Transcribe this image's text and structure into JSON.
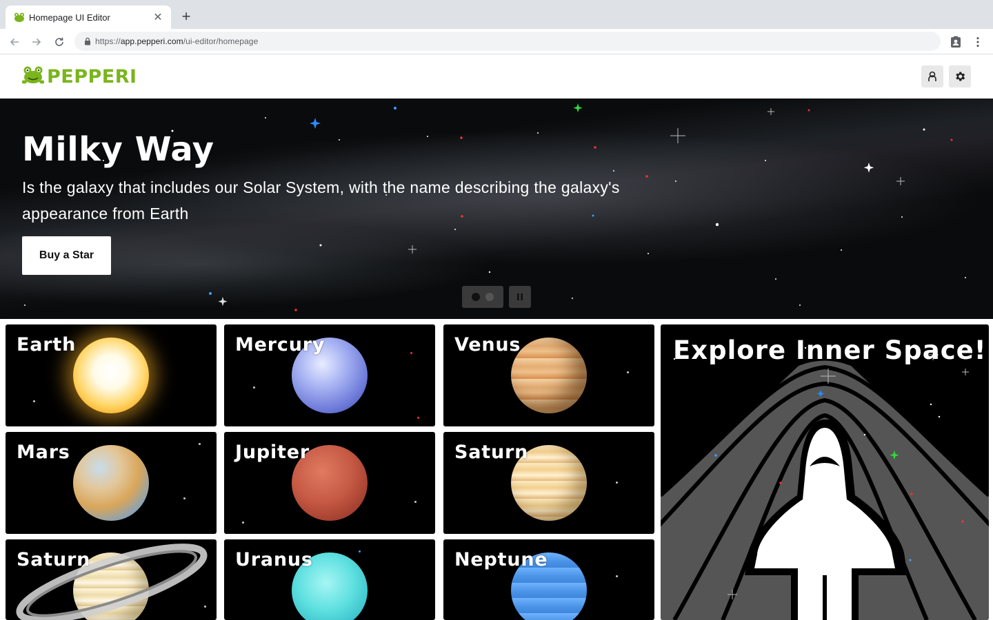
{
  "browser": {
    "tab_title": "Homepage UI Editor",
    "url_scheme": "https://",
    "url_host": "app.pepperi.com",
    "url_path": "/ui-editor/homepage"
  },
  "header": {
    "logo_text": "PEPPERI",
    "brand_color": "#7ab51d"
  },
  "hero": {
    "title": "Milky Way",
    "subtitle": "Is the galaxy that includes our Solar System, with the name describing the galaxy's appearance from Earth",
    "cta_label": "Buy a Star",
    "slides_total": 2,
    "active_slide": 1
  },
  "planets": [
    {
      "name": "Earth",
      "color": "#ffd46a"
    },
    {
      "name": "Mercury",
      "color": "#8e9be8"
    },
    {
      "name": "Venus",
      "color": "#e0a264"
    },
    {
      "name": "Mars",
      "color": "#d9ad6a"
    },
    {
      "name": "Jupiter",
      "color": "#c65a45"
    },
    {
      "name": "Saturn",
      "color": "#f1d59c"
    },
    {
      "name": "Saturn",
      "color": "#f4e6c0"
    },
    {
      "name": "Uranus",
      "color": "#5fe0e0"
    },
    {
      "name": "Neptune",
      "color": "#4c95e8"
    }
  ],
  "promo": {
    "title": "Explore Inner Space!"
  }
}
